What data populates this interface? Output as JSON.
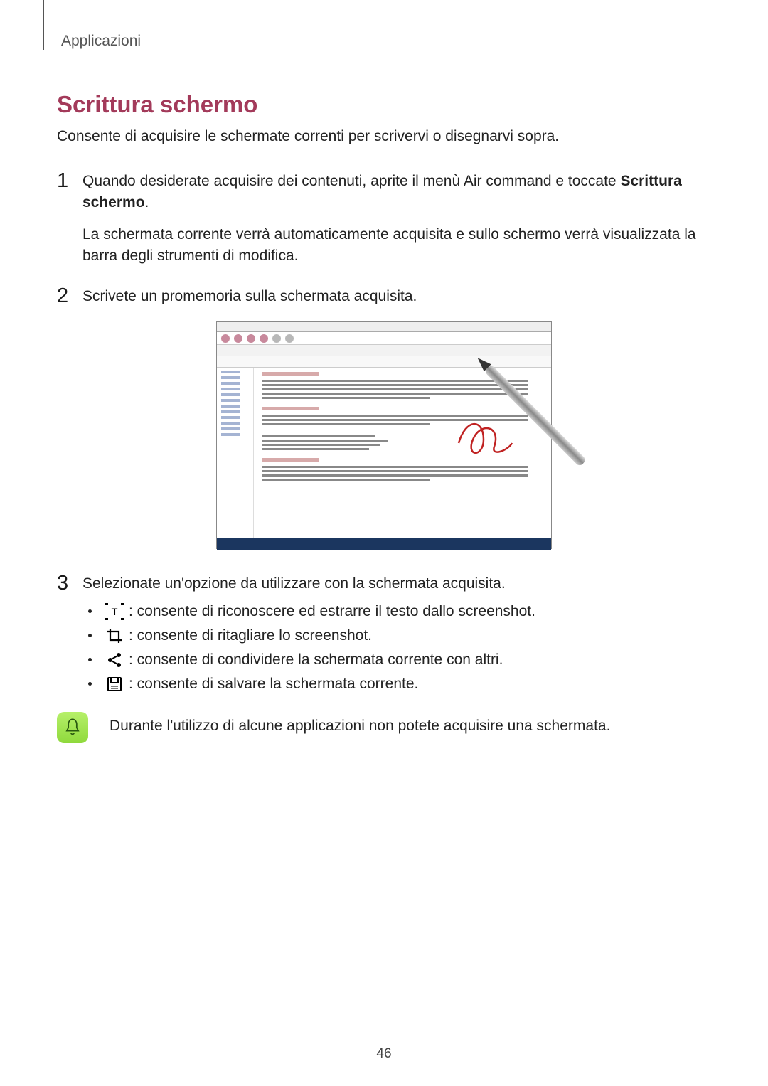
{
  "header": {
    "category": "Applicazioni"
  },
  "section": {
    "title": "Scrittura schermo",
    "intro": "Consente di acquisire le schermate correnti per scrivervi o disegnarvi sopra."
  },
  "steps": {
    "s1": {
      "num": "1",
      "text_a": "Quando desiderate acquisire dei contenuti, aprite il menù Air command e toccate ",
      "bold": "Scrittura schermo",
      "period": ".",
      "text_b": "La schermata corrente verrà automaticamente acquisita e sullo schermo verrà visualizzata la barra degli strumenti di modifica."
    },
    "s2": {
      "num": "2",
      "text": "Scrivete un promemoria sulla schermata acquisita."
    },
    "s3": {
      "num": "3",
      "text": "Selezionate un'opzione da utilizzare con la schermata acquisita."
    }
  },
  "bullets": {
    "b1": " : consente di riconoscere ed estrarre il testo dallo screenshot.",
    "b2": " : consente di ritagliare lo screenshot.",
    "b3": " : consente di condividere la schermata corrente con altri.",
    "b4": " : consente di salvare la schermata corrente."
  },
  "note": {
    "text": "Durante l'utilizzo di alcune applicazioni non potete acquisire una schermata."
  },
  "page_number": "46"
}
